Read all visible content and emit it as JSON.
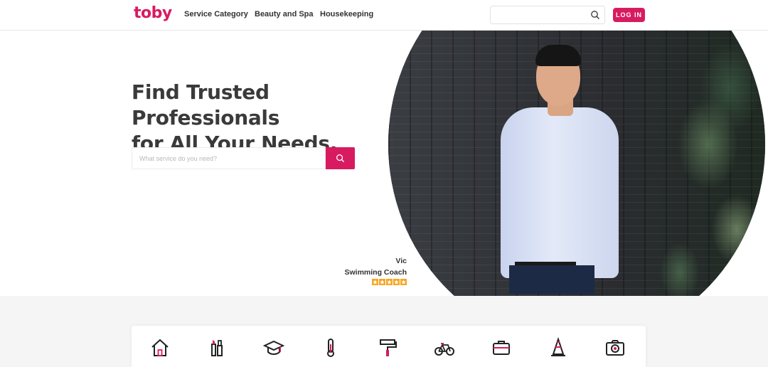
{
  "header": {
    "logo": "toby",
    "nav": [
      {
        "label": "Service Category"
      },
      {
        "label": "Beauty and Spa"
      },
      {
        "label": "Housekeeping"
      }
    ],
    "search_placeholder": "",
    "login_label": "LOG IN"
  },
  "hero": {
    "title_line1": "Find Trusted Professionals",
    "title_line2": "for All Your Needs.",
    "search_placeholder": "What service do you need?",
    "caption_name": "Vic",
    "caption_role": "Swimming Coach",
    "rating_stars": 5
  },
  "categories": {
    "icons": [
      "home-icon",
      "cosmetics-icon",
      "graduation-cap-icon",
      "thermometer-icon",
      "paint-roller-icon",
      "bicycle-icon",
      "briefcase-icon",
      "traffic-cone-icon",
      "camera-icon"
    ]
  },
  "colors": {
    "brand": "#d81b60",
    "star": "#f5a623",
    "text": "#333333"
  }
}
